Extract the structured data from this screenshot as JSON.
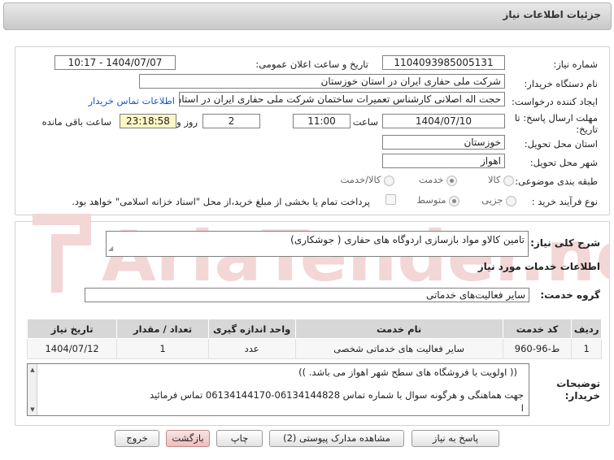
{
  "header": {
    "title": "جزئیات اطلاعات نیاز"
  },
  "form": {
    "need_number_label": "شماره نیاز:",
    "need_number": "1104093985005131",
    "announce_label": "تاریخ و ساعت اعلان عمومی:",
    "announce_value": "1404/07/07 - 10:17",
    "buyer_label": "نام دستگاه خریدار:",
    "buyer_value": "شرکت ملی حفاری ایران در استان خوزستان",
    "creator_label": "ایجاد کننده درخواست:",
    "creator_value": "حجت اله اصلانی کارشناس تعمیرات ساختمان شرکت ملی حفاری ایران در استان",
    "contact_link": "اطلاعات تماس خریدار",
    "deadline_label": "مهلت ارسال پاسخ: تا",
    "deadline_label2": "تاریخ:",
    "deadline_date": "1404/07/10",
    "time_label": "ساعت",
    "deadline_time": "11:00",
    "days_value": "2",
    "days_label": "روز و",
    "remaining_value": "23:18:58",
    "remaining_label": "ساعت باقی مانده",
    "province_label": "استان محل تحویل:",
    "province_value": "خوزستان",
    "city_label": "شهر محل تحویل:",
    "city_value": "اهواز",
    "category_label": "طبقه بندی موضوعی:",
    "category_options": [
      "کالا",
      "خدمت",
      "کالا/خدمت"
    ],
    "category_selected": "خدمت",
    "process_label": "نوع فرآیند خرید :",
    "process_options": [
      "جزیی",
      "متوسط"
    ],
    "process_selected": "متوسط",
    "payment_note": "پرداخت تمام یا بخشی از مبلغ خرید،از محل \"اسناد خزانه اسلامی\" خواهد بود."
  },
  "description": {
    "label": "شرح کلی نیاز:",
    "value": "تامین کالاو مواد بازسازی اردوگاه های حفاری ( جوشکاری)"
  },
  "services": {
    "section_title": "اطلاعات خدمات مورد نیاز",
    "group_label": "گروه خدمت:",
    "group_value": "سایر فعالیت‌های خدماتی",
    "columns": [
      "ردیف",
      "کد خدمت",
      "نام خدمت",
      "واحد اندازه گیری",
      "تعداد / مقدار",
      "تاریخ نیاز"
    ],
    "rows": [
      [
        "1",
        "ط-96-960",
        "سایر فعالیت های خدماتی شخصی",
        "عدد",
        "1",
        "1404/07/12"
      ]
    ]
  },
  "notes": {
    "label_line1": "توضیحات",
    "label_line2": "خریدار:",
    "lines": [
      "((  اولویت با فروشگاه های سطح شهر اهواز می باشد. ))",
      "جهت هماهنگی و هرگونه سوال با شماره تماس 06134144828-06134144170 تماس فرمائید",
      "ا"
    ]
  },
  "buttons": {
    "reply": "پاسخ به نیاز",
    "attachments": "مشاهده مدارک پیوستی (2)",
    "print": "چاپ",
    "back": "بازگشت",
    "exit": "خروج"
  },
  "watermark": {
    "text": "AriaTender.net"
  },
  "colors": {
    "link": "#1a56c8",
    "remaining_bg": "#fdf6c6",
    "table_header": "#d7d7d7",
    "watermark": "#f3d6d6"
  }
}
